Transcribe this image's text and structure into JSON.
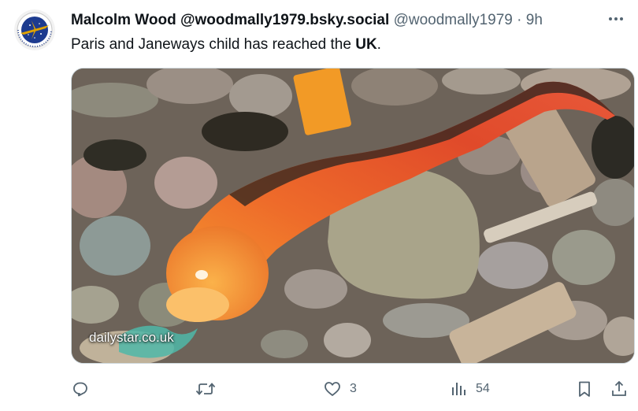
{
  "author": {
    "display_name": "Malcolm Wood @woodmally1979.bsky.social",
    "handle": "@woodmally1979",
    "separator": "·",
    "time": "9h",
    "avatar_icon": "starfleet-emblem-icon"
  },
  "tweet": {
    "text_before": "Paris and Janeways child has reached the ",
    "text_bold": "UK",
    "text_after": "."
  },
  "media": {
    "watermark": "dailystar.co.uk",
    "subject": "photo-of-orange-creature-on-pebble-beach"
  },
  "actions": {
    "reply_icon": "reply-icon",
    "retweet_icon": "retweet-icon",
    "like_icon": "heart-icon",
    "like_count": "3",
    "views_icon": "views-chart-icon",
    "views_count": "54",
    "bookmark_icon": "bookmark-icon",
    "share_icon": "share-icon"
  },
  "colors": {
    "text": "#0f1419",
    "secondary": "#536471",
    "border": "#cfd9de",
    "avatar_blue": "#1d3b8f",
    "avatar_gold": "#e0a300"
  }
}
